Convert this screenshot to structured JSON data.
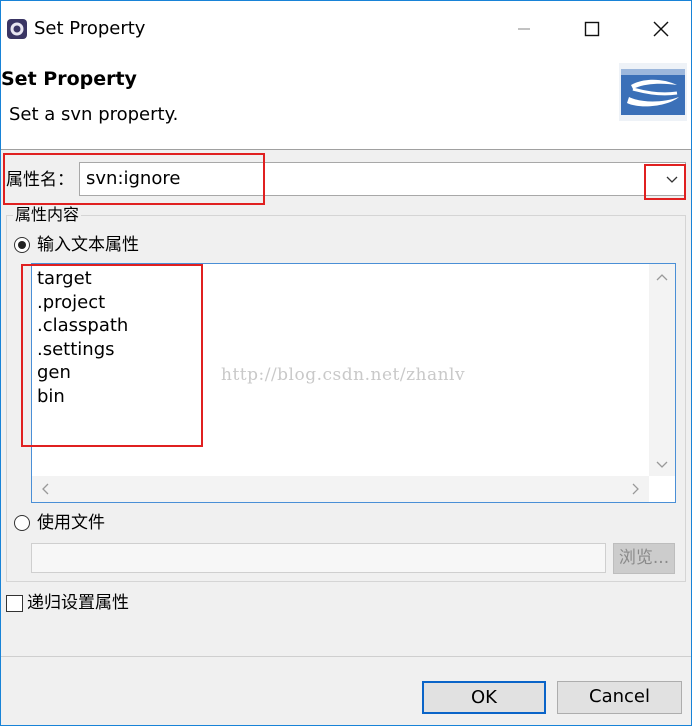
{
  "window": {
    "title": "Set Property",
    "minimize_icon": "minimize-icon",
    "maximize_icon": "maximize-icon",
    "close_icon": "close-icon"
  },
  "header": {
    "title": "Set Property",
    "description": "Set a svn property."
  },
  "property": {
    "label": "属性名：",
    "value": "svn:ignore"
  },
  "content_group": {
    "title": "属性内容",
    "text_option_label": "输入文本属性",
    "text_option_checked": true,
    "text_lines": [
      "target",
      ".project",
      ".classpath",
      ".settings",
      "gen",
      "bin"
    ],
    "file_option_label": "使用文件",
    "file_option_checked": false,
    "file_path": "",
    "browse_label": "浏览..."
  },
  "recursive": {
    "label": "递归设置属性",
    "checked": false
  },
  "watermark": "http://blog.csdn.net/zhanlv",
  "buttons": {
    "ok": "OK",
    "cancel": "Cancel"
  },
  "colors": {
    "accent": "#0a64c8",
    "annotation": "#e02020",
    "window_border": "#1883d7"
  }
}
